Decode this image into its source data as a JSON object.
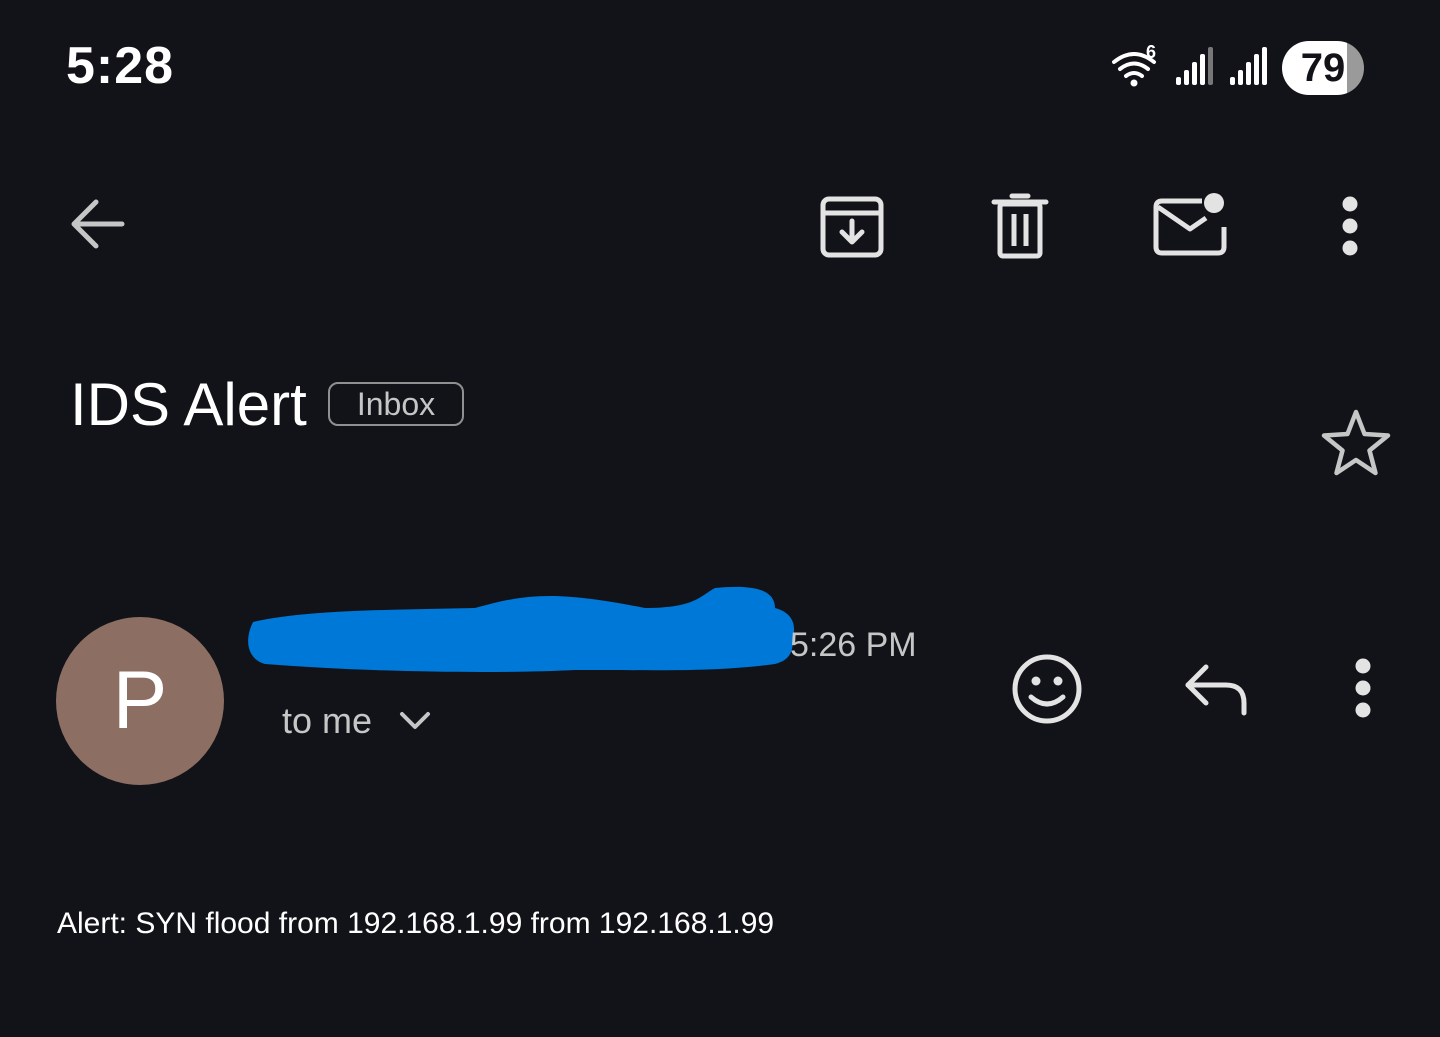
{
  "status_bar": {
    "time": "5:28",
    "wifi_badge": "6",
    "battery_level": "79",
    "battery_fraction": 0.79
  },
  "toolbar": {
    "back_icon": "arrow-back-icon",
    "actions": [
      "archive-icon",
      "trash-icon",
      "mark-unread-icon",
      "more-vert-icon"
    ]
  },
  "email": {
    "subject": "IDS Alert",
    "label": "Inbox",
    "sender_initial": "P",
    "avatar_color": "#8d6e63",
    "time": "5:26 PM",
    "recipient": "to me",
    "body": "Alert: SYN flood from 192.168.1.99 from 192.168.1.99"
  },
  "colors": {
    "background": "#111318",
    "redaction": "#0078d7",
    "text_primary": "#ffffff",
    "text_secondary": "#c4c7c5"
  }
}
